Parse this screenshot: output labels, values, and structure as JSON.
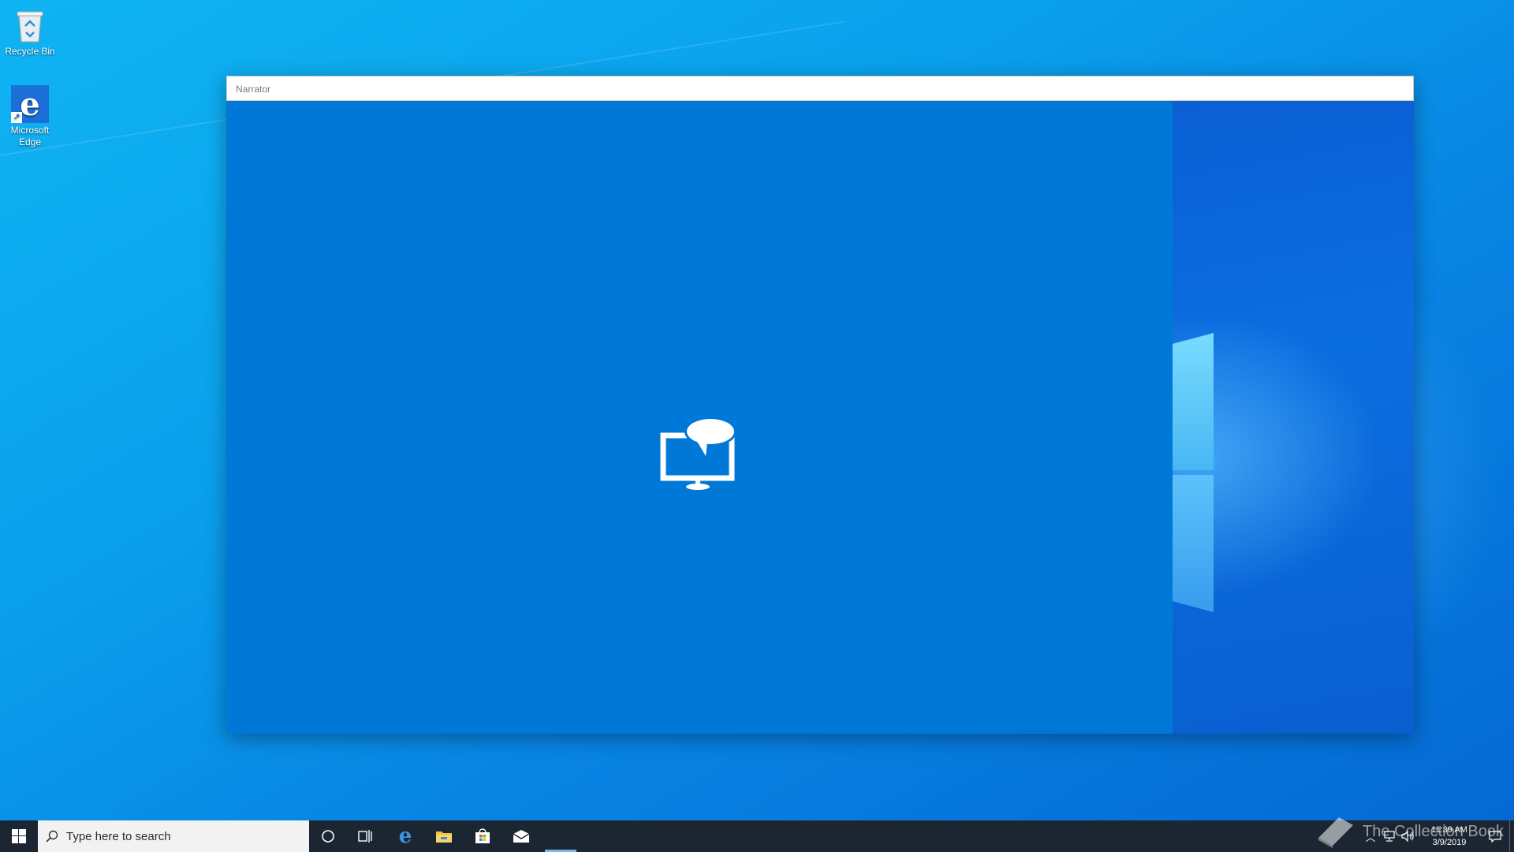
{
  "desktop": {
    "icons": [
      {
        "label": "Recycle Bin",
        "icon": "recycle-bin-icon"
      },
      {
        "label": "Microsoft Edge",
        "icon": "edge-icon"
      }
    ]
  },
  "window": {
    "title": "Narrator",
    "icon": "narrator-icon",
    "accent": "#0078d7"
  },
  "taskbar": {
    "search_placeholder": "Type here to search",
    "pinned": [
      "edge-icon",
      "file-explorer-icon",
      "store-icon",
      "mail-icon"
    ],
    "clock_time": "11:39 AM",
    "clock_date": "3/9/2019"
  },
  "watermark": {
    "text": "The Collection Book"
  }
}
